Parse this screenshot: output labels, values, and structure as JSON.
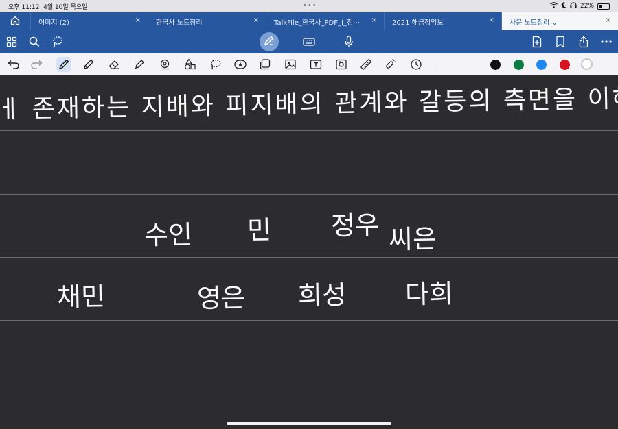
{
  "status_bar": {
    "time": "오후 11:12",
    "date": "4월 10일 목요일",
    "battery": "22%",
    "battery_level": 0.22
  },
  "tabs": [
    {
      "label": "이미지 (2)",
      "active": false
    },
    {
      "label": "한국사 노트정리",
      "active": false
    },
    {
      "label": "TalkFile_한국사_PDF_I_전⋯",
      "active": false
    },
    {
      "label": "2021 해금정악보",
      "active": false
    },
    {
      "label": "사문 노트정리 ⌄",
      "active": true
    }
  ],
  "tab_close_glyph": "×",
  "colors": {
    "tabbar": "#27579f",
    "swatch_black": "#111111",
    "swatch_green": "#0c7a45",
    "swatch_blue": "#1f87f0",
    "swatch_red": "#d6141d",
    "canvas": "#2c2c2e"
  },
  "icons": {
    "toolbar": [
      "home-icon",
      "grid-icon",
      "search-icon",
      "lasso-icon",
      "pen-mode-icon",
      "keyboard-icon",
      "microphone-icon",
      "add-page-icon",
      "bookmark-icon",
      "share-icon",
      "more-icon"
    ],
    "tools": [
      "undo-icon",
      "redo-icon",
      "pen-icon",
      "pencil-icon",
      "eraser-icon",
      "highlighter-icon",
      "shape-icon",
      "elements-icon",
      "lasso-select-icon",
      "sticker-icon",
      "sticky-note-icon",
      "image-icon",
      "text-box-icon",
      "camera-icon",
      "ruler-icon",
      "laser-pointer-icon",
      "timer-icon"
    ]
  },
  "note": {
    "line1": "ㅔ 존재하는 지배와 피지배의 관계와 갈등의 측면을 이해하는",
    "line2_words": [
      "수인",
      "민",
      "정우",
      "씨은"
    ],
    "line3_words": [
      "채민",
      "영은",
      "희성",
      "다희"
    ]
  }
}
